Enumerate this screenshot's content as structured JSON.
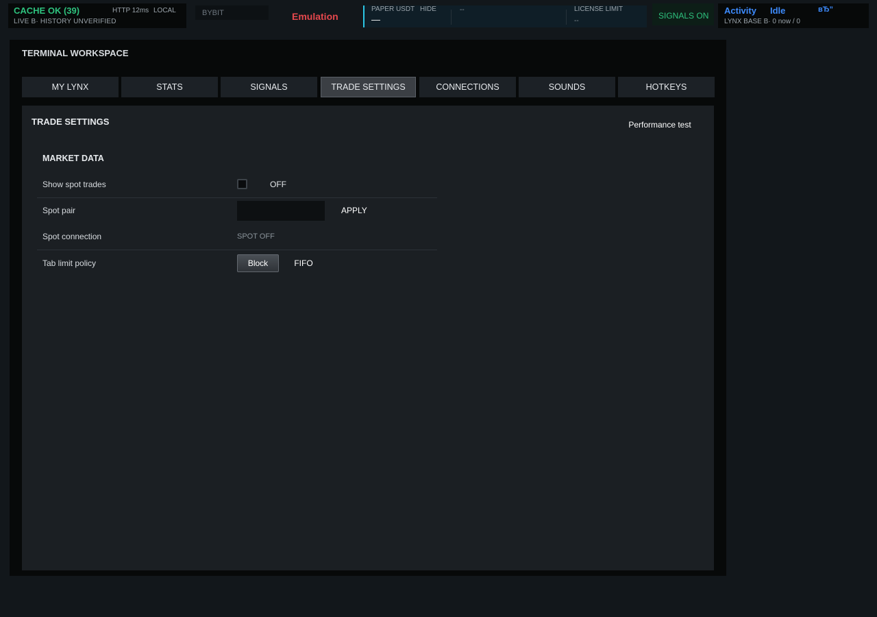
{
  "status": {
    "cache": {
      "title": "CACHE OK (39)",
      "http": "HTTP 12ms",
      "mode": "LOCAL",
      "subtitle": "LIVE B· HISTORY UNVERIFIED"
    },
    "exchange": "BYBIT",
    "emulation": "Emulation",
    "paper": {
      "label": "PAPER USDT",
      "hide": "HIDE",
      "value": "—",
      "dash": "--"
    },
    "license": {
      "label": "LICENSE LIMIT",
      "value": "--"
    },
    "signals": "SIGNALS ON",
    "activity": {
      "label": "Activity",
      "state": "Idle",
      "glyph": " вЂ”",
      "subtitle": "LYNX BASE B· 0 now / 0"
    }
  },
  "workspace": {
    "title": "TERMINAL WORKSPACE",
    "tabs": [
      {
        "label": "MY LYNX"
      },
      {
        "label": "STATS"
      },
      {
        "label": "SIGNALS"
      },
      {
        "label": "TRADE SETTINGS",
        "active": true
      },
      {
        "label": "CONNECTIONS"
      },
      {
        "label": "SOUNDS"
      },
      {
        "label": "HOTKEYS"
      }
    ]
  },
  "panel": {
    "title": "TRADE SETTINGS",
    "performance_button": "Performance test",
    "market_data": {
      "title": "MARKET DATA",
      "show_spot_trades": {
        "label": "Show spot trades",
        "checked": false,
        "state": "OFF"
      },
      "spot_pair": {
        "label": "Spot pair",
        "value": "",
        "apply": "APPLY"
      },
      "spot_connection": {
        "label": "Spot connection",
        "value": "SPOT OFF"
      },
      "tab_limit_policy": {
        "label": "Tab limit policy",
        "options": [
          "Block",
          "FIFO"
        ],
        "selected": "Block"
      }
    }
  },
  "colors": {
    "ok_green": "#2ec27e",
    "emulation_red": "#e5484d",
    "activity_blue": "#3d8bfd",
    "paper_accent": "#2bc7e6"
  }
}
